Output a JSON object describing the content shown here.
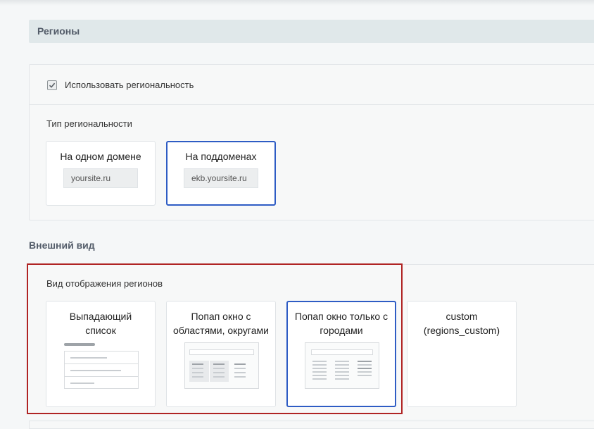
{
  "section": {
    "title": "Регионы"
  },
  "regionality": {
    "checkbox_label": "Использовать региональность",
    "checked": true,
    "type_label": "Тип региональности",
    "options": [
      {
        "title": "На одном домене",
        "example": "yoursite.ru",
        "selected": false
      },
      {
        "title": "На поддоменах",
        "example": "ekb.yoursite.ru",
        "selected": true
      }
    ]
  },
  "appearance": {
    "title": "Внешний вид",
    "display_label": "Вид отображения регионов",
    "options": [
      {
        "title_line1": "Выпадающий",
        "title_line2": "список",
        "preview": "dropdown-preview",
        "selected": false
      },
      {
        "title_line1": "Попап окно с",
        "title_line2": "областями, округами",
        "preview": "popup-regions-preview",
        "selected": false
      },
      {
        "title_line1": "Попап окно только с",
        "title_line2": "городами",
        "preview": "popup-cities-preview",
        "selected": true
      },
      {
        "title_line1": "custom",
        "title_line2": "(regions_custom)",
        "preview": "",
        "selected": false
      }
    ]
  },
  "colors": {
    "accent": "#2e5cc4",
    "highlight": "#b02424",
    "header_bg": "#e0e8ea"
  }
}
